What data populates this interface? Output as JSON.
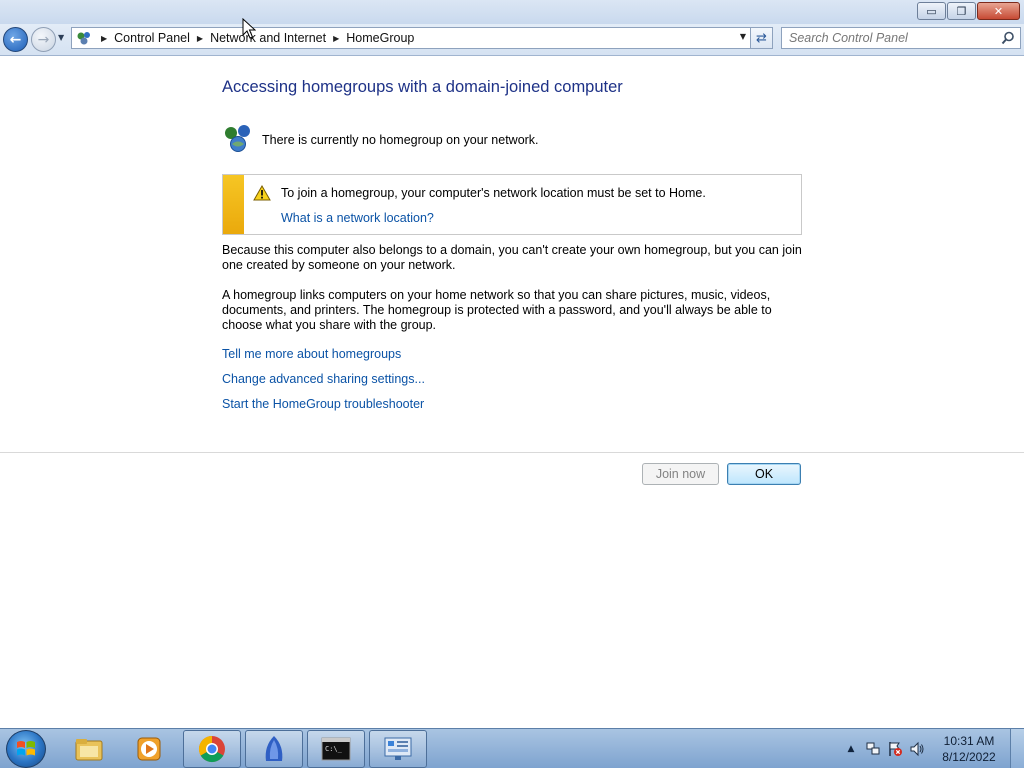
{
  "window": {
    "minimize_glyph": "▭",
    "restore_glyph": "❐",
    "close_glyph": "✕"
  },
  "navigation": {
    "breadcrumbs": [
      "Control Panel",
      "Network and Internet",
      "HomeGroup"
    ],
    "search_placeholder": "Search Control Panel"
  },
  "main": {
    "heading": "Accessing homegroups with a domain-joined computer",
    "status_text": "There is currently no homegroup on your network.",
    "warning": {
      "message": "To join a homegroup, your computer's network location must be set to Home.",
      "link": "What is a network location?"
    },
    "paragraph1": "Because this computer also belongs to a domain, you can't create your own homegroup, but you can join one created by someone on your network.",
    "paragraph2": "A homegroup links computers on your home network so that you can share pictures, music, videos, documents, and printers. The homegroup is protected with a password, and you'll always be able to choose what you share with the group.",
    "links": [
      "Tell me more about homegroups",
      "Change advanced sharing settings...",
      "Start the HomeGroup troubleshooter"
    ]
  },
  "buttons": {
    "join_now": "Join now",
    "ok": "OK"
  },
  "taskbar": {
    "items": [
      "windows-explorer",
      "media-player",
      "chrome",
      "file-manager",
      "command-prompt",
      "control-panel"
    ],
    "clock_time": "10:31 AM",
    "clock_date": "8/12/2022"
  },
  "colors": {
    "heading": "#1e3287",
    "link": "#0b53a6",
    "warning_stripe": "#f1bb18"
  }
}
